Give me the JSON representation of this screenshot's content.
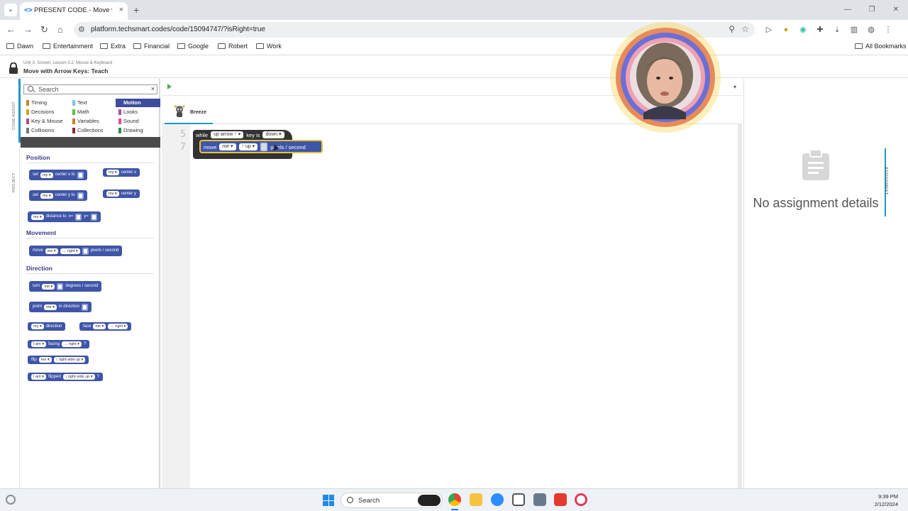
{
  "browser": {
    "tab_title": "PRESENT CODE - Move with Arrow Keys: Teach",
    "tab_close": "×",
    "new_tab": "+",
    "url": "platform.techsmart.codes/code/15094747/?isRight=true",
    "bookmarks": [
      "Dawn",
      "Entertainment",
      "Extra",
      "Financial",
      "Google",
      "Robert",
      "Work"
    ],
    "all_bookmarks": "All Bookmarks"
  },
  "app": {
    "breadcrumb": "Unit 3: Screen, Lesson 3.2: Mouse & Keyboard",
    "title": "Move with Arrow Keys: Teach",
    "rail": {
      "code_assist": "CODE ASSIST",
      "project": "PROJECT"
    }
  },
  "assist": {
    "search_placeholder": "Search",
    "clear": "×",
    "categories": [
      {
        "label": "Timing",
        "color": "#c9852b"
      },
      {
        "label": "Text",
        "color": "#79c7e4"
      },
      {
        "label": "Motion",
        "color": "#3d4d9c"
      },
      {
        "label": "Decisions",
        "color": "#c9a92b"
      },
      {
        "label": "Math",
        "color": "#5fbf3f"
      },
      {
        "label": "Looks",
        "color": "#b34fa0"
      },
      {
        "label": "Key & Mouse",
        "color": "#b0506a"
      },
      {
        "label": "Variables",
        "color": "#d9772f"
      },
      {
        "label": "Sound",
        "color": "#d44f9a"
      },
      {
        "label": "Collisions",
        "color": "#777777"
      },
      {
        "label": "Collections",
        "color": "#8a2b2b"
      },
      {
        "label": "Drawing",
        "color": "#2e8b57"
      }
    ],
    "active_category": "Motion",
    "sections": {
      "position": "Position",
      "movement": "Movement",
      "direction": "Direction"
    },
    "blocks": {
      "set_cx": [
        "set",
        "my ▾",
        "center x to"
      ],
      "get_cx": [
        "my ▾",
        "center x"
      ],
      "set_cy": [
        "set",
        "my ▾",
        "center y to"
      ],
      "get_cy": [
        "my ▾",
        "center y"
      ],
      "distance": [
        "my ▾",
        "distance to",
        "x=",
        "y="
      ],
      "move": [
        "move",
        "me ▾",
        "→ right ▾",
        "pixels / second"
      ],
      "turn": [
        "turn",
        "me ▾",
        "degrees / second"
      ],
      "point": [
        "point",
        "me ▾",
        "in direction"
      ],
      "direction": [
        "my ▾",
        "direction"
      ],
      "face": [
        "face",
        "me ▾",
        "→ right ▾"
      ],
      "facing": [
        "I am ▾",
        "facing",
        "→ right ▾",
        "?"
      ],
      "flip": [
        "flip",
        "me ▾",
        "↕ right-side up ▾"
      ],
      "flipped": [
        "I am ▾",
        "flipped",
        "↕ right-side up ▾",
        "?"
      ]
    }
  },
  "editor": {
    "file_tab": "Breeze",
    "line_numbers": [
      "5",
      "7"
    ],
    "while_block": {
      "kw": "while",
      "key": "up arrow ↑ ▾",
      "is": "key is",
      "state": "down ▾"
    },
    "move_block": {
      "kw": "move",
      "who": "me ▾",
      "dir": "↑ up ▾",
      "unit": "pixels / second"
    }
  },
  "assignment": {
    "tab_label": "ASSIGNMENT",
    "empty_text": "No assignment details"
  },
  "taskbar": {
    "search": "Search",
    "time": "9:39 PM",
    "date": "2/12/2024"
  }
}
